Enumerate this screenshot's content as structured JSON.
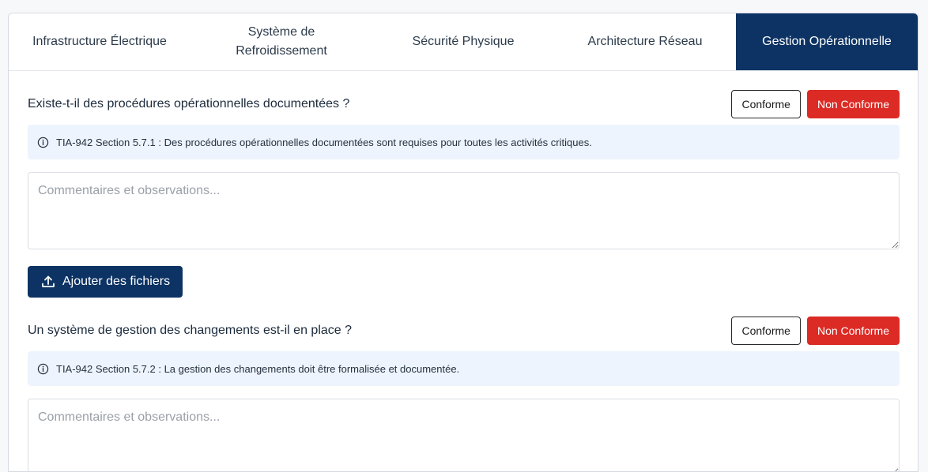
{
  "tabs": [
    {
      "label": "Infrastructure Électrique"
    },
    {
      "label": "Système de Refroidissement"
    },
    {
      "label": "Sécurité Physique"
    },
    {
      "label": "Architecture Réseau"
    },
    {
      "label": "Gestion Opérationnelle"
    }
  ],
  "active_tab": "Gestion Opérationnelle",
  "questions": [
    {
      "text": "Existe-t-il des procédures opérationnelles documentées ?",
      "conforme_label": "Conforme",
      "non_conforme_label": "Non Conforme",
      "info": "TIA-942 Section 5.7.1 : Des procédures opérationnelles documentées sont requises pour toutes les activités critiques.",
      "comment_placeholder": "Commentaires et observations...",
      "upload_label": "Ajouter des fichiers"
    },
    {
      "text": "Un système de gestion des changements est-il en place ?",
      "conforme_label": "Conforme",
      "non_conforme_label": "Non Conforme",
      "info": "TIA-942 Section 5.7.2 : La gestion des changements doit être formalisée et documentée.",
      "comment_placeholder": "Commentaires et observations..."
    }
  ],
  "icons": {
    "info": "info-circle-icon",
    "upload": "upload-icon"
  },
  "colors": {
    "primary": "#0c3363",
    "danger": "#dc2b25",
    "info_bg": "#eef4fd"
  }
}
